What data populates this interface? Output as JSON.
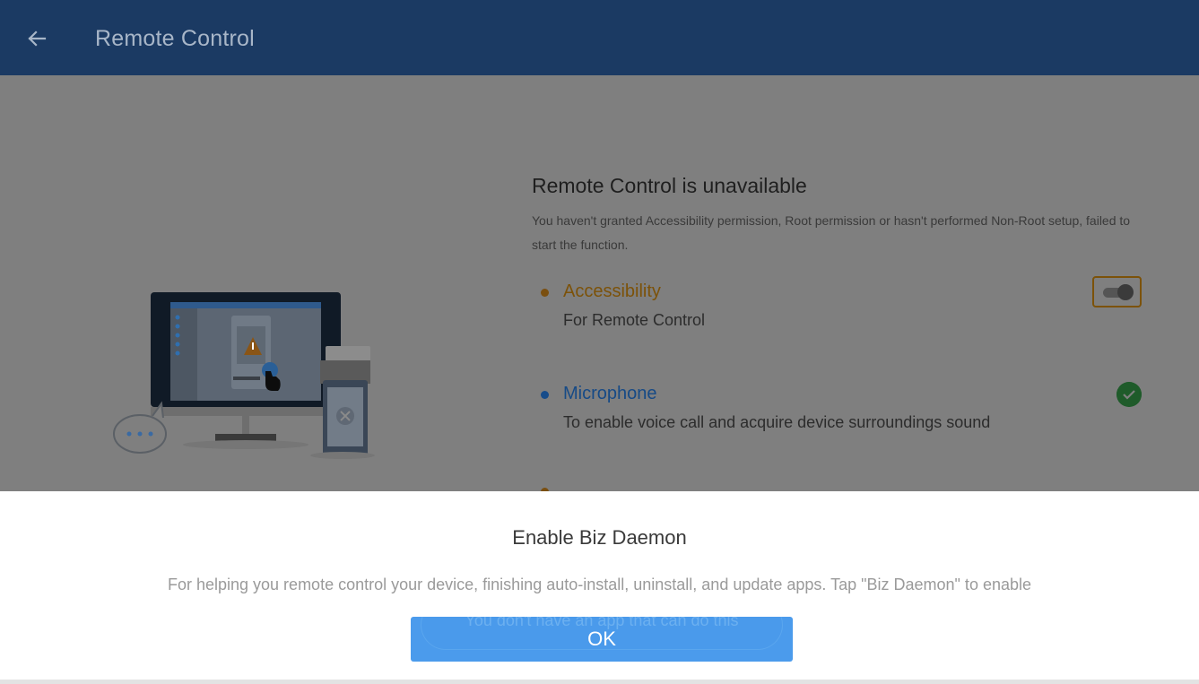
{
  "appbar": {
    "back_icon": "arrow-left-icon",
    "title": "Remote Control"
  },
  "panel": {
    "heading": "Remote Control is unavailable",
    "description": "You haven't granted Accessibility permission, Root permission or hasn't performed Non-Root setup, failed to start the function."
  },
  "permissions": [
    {
      "name": "Accessibility",
      "description": "For Remote Control",
      "status": "toggle-off"
    },
    {
      "name": "Microphone",
      "description": "To enable voice call and acquire device surroundings sound",
      "status": "granted"
    }
  ],
  "dialog": {
    "title": "Enable Biz Daemon",
    "message": "For helping you remote control your device, finishing auto-install, uninstall, and update apps. Tap \"Biz Daemon\" to enable",
    "ghost_text": "You don't have an app that can do this",
    "ok_label": "OK"
  },
  "colors": {
    "appbar": "#1b3a63",
    "accent_orange": "#7c5209",
    "accent_blue": "#164a86",
    "ok_button": "#4b9bec"
  }
}
